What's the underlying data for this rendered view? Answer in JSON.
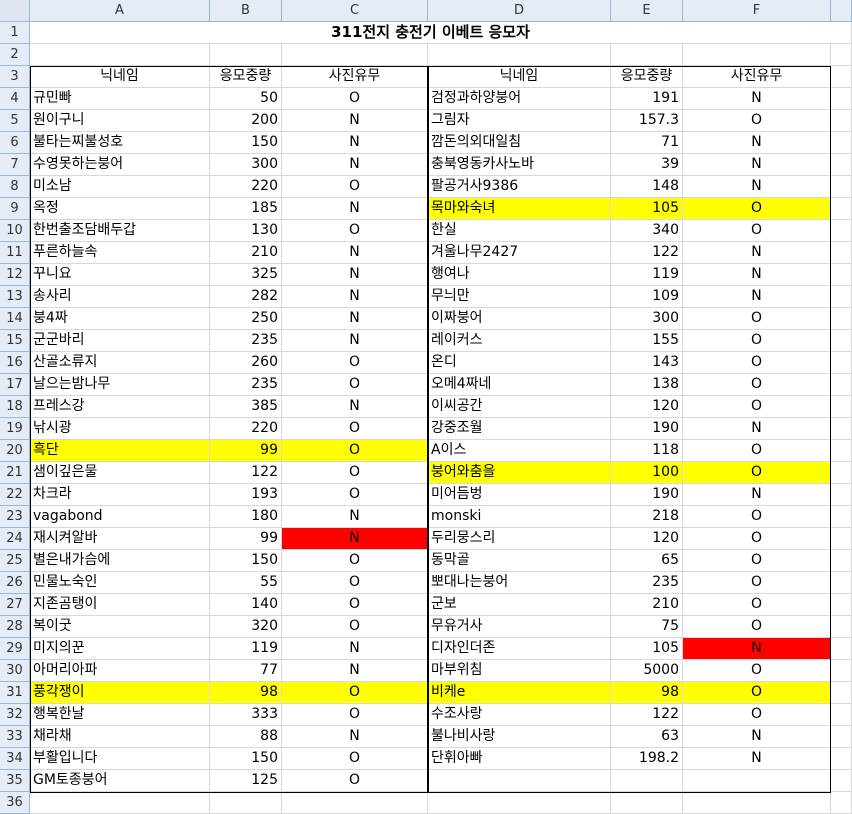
{
  "columns": [
    "A",
    "B",
    "C",
    "D",
    "E",
    "F"
  ],
  "row_count": 36,
  "title": "311전지 충전기 이베트 응모자",
  "headers": [
    "닉네임",
    "응모중량",
    "사진유무"
  ],
  "left": [
    {
      "row": 4,
      "name": "규민빠",
      "weight": "50",
      "photo": "O"
    },
    {
      "row": 5,
      "name": "원이구니",
      "weight": "200",
      "photo": "N"
    },
    {
      "row": 6,
      "name": "불타는찌불성호",
      "weight": "150",
      "photo": "N"
    },
    {
      "row": 7,
      "name": "수영못하는붕어",
      "weight": "300",
      "photo": "N"
    },
    {
      "row": 8,
      "name": "미소남",
      "weight": "220",
      "photo": "O"
    },
    {
      "row": 9,
      "name": "옥정",
      "weight": "185",
      "photo": "N"
    },
    {
      "row": 10,
      "name": "한번출조담배두갑",
      "weight": "130",
      "photo": "O"
    },
    {
      "row": 11,
      "name": "푸른하늘속",
      "weight": "210",
      "photo": "N"
    },
    {
      "row": 12,
      "name": "꾸니요",
      "weight": "325",
      "photo": "N"
    },
    {
      "row": 13,
      "name": "송사리",
      "weight": "282",
      "photo": "N"
    },
    {
      "row": 14,
      "name": "붕4짜",
      "weight": "250",
      "photo": "N"
    },
    {
      "row": 15,
      "name": "군군바리",
      "weight": "235",
      "photo": "N"
    },
    {
      "row": 16,
      "name": "산골소류지",
      "weight": "260",
      "photo": "O"
    },
    {
      "row": 17,
      "name": "날으는밤나무",
      "weight": "235",
      "photo": "O"
    },
    {
      "row": 18,
      "name": "프레스강",
      "weight": "385",
      "photo": "N"
    },
    {
      "row": 19,
      "name": "낚시광",
      "weight": "220",
      "photo": "O"
    },
    {
      "row": 20,
      "name": "흑단",
      "weight": "99",
      "photo": "O",
      "hl": "yellow"
    },
    {
      "row": 21,
      "name": "샘이깊은물",
      "weight": "122",
      "photo": "O"
    },
    {
      "row": 22,
      "name": "차크라",
      "weight": "193",
      "photo": "O"
    },
    {
      "row": 23,
      "name": "vagabond",
      "weight": "180",
      "photo": "N"
    },
    {
      "row": 24,
      "name": "재시켜알바",
      "weight": "99",
      "photo": "N",
      "hl_photo": "red"
    },
    {
      "row": 25,
      "name": "별은내가슴에",
      "weight": "150",
      "photo": "O"
    },
    {
      "row": 26,
      "name": "민물노숙인",
      "weight": "55",
      "photo": "O"
    },
    {
      "row": 27,
      "name": "지존곰탱이",
      "weight": "140",
      "photo": "O"
    },
    {
      "row": 28,
      "name": "복이굿",
      "weight": "320",
      "photo": "O"
    },
    {
      "row": 29,
      "name": "미지의꾼",
      "weight": "119",
      "photo": "N"
    },
    {
      "row": 30,
      "name": "아머리아파",
      "weight": "77",
      "photo": "N"
    },
    {
      "row": 31,
      "name": "풍각쟁이",
      "weight": "98",
      "photo": "O",
      "hl": "yellow"
    },
    {
      "row": 32,
      "name": "행복한날",
      "weight": "333",
      "photo": "O"
    },
    {
      "row": 33,
      "name": "채라채",
      "weight": "88",
      "photo": "N"
    },
    {
      "row": 34,
      "name": "부활입니다",
      "weight": "150",
      "photo": "O"
    },
    {
      "row": 35,
      "name": "GM토종붕어",
      "weight": "125",
      "photo": "O"
    }
  ],
  "right": [
    {
      "row": 4,
      "name": "검정과하양붕어",
      "weight": "191",
      "photo": "N"
    },
    {
      "row": 5,
      "name": "그림자",
      "weight": "157.3",
      "photo": "O"
    },
    {
      "row": 6,
      "name": "깜돈의외대일침",
      "weight": "71",
      "photo": "N"
    },
    {
      "row": 7,
      "name": "충북영동카사노바",
      "weight": "39",
      "photo": "N"
    },
    {
      "row": 8,
      "name": "팔공거사9386",
      "weight": "148",
      "photo": "N"
    },
    {
      "row": 9,
      "name": "목마와숙녀",
      "weight": "105",
      "photo": "O",
      "hl": "yellow"
    },
    {
      "row": 10,
      "name": "한실",
      "weight": "340",
      "photo": "O"
    },
    {
      "row": 11,
      "name": "겨울나무2427",
      "weight": "122",
      "photo": "N"
    },
    {
      "row": 12,
      "name": "행여나",
      "weight": "119",
      "photo": "N"
    },
    {
      "row": 13,
      "name": "무늬만",
      "weight": "109",
      "photo": "N"
    },
    {
      "row": 14,
      "name": "이짜붕어",
      "weight": "300",
      "photo": "O"
    },
    {
      "row": 15,
      "name": "레이커스",
      "weight": "155",
      "photo": "O"
    },
    {
      "row": 16,
      "name": "온디",
      "weight": "143",
      "photo": "O"
    },
    {
      "row": 17,
      "name": "오메4짜네",
      "weight": "138",
      "photo": "O"
    },
    {
      "row": 18,
      "name": "이씨공간",
      "weight": "120",
      "photo": "O"
    },
    {
      "row": 19,
      "name": "강중조월",
      "weight": "190",
      "photo": "N"
    },
    {
      "row": 20,
      "name": "A이스",
      "weight": "118",
      "photo": "O"
    },
    {
      "row": 21,
      "name": "붕어와춤을",
      "weight": "100",
      "photo": "O",
      "hl": "yellow"
    },
    {
      "row": 22,
      "name": "미어듬벙",
      "weight": "190",
      "photo": "N"
    },
    {
      "row": 23,
      "name": "monski",
      "weight": "218",
      "photo": "O"
    },
    {
      "row": 24,
      "name": "두리뭉스리",
      "weight": "120",
      "photo": "O"
    },
    {
      "row": 25,
      "name": "동막골",
      "weight": "65",
      "photo": "O"
    },
    {
      "row": 26,
      "name": "뽀대나는붕어",
      "weight": "235",
      "photo": "O"
    },
    {
      "row": 27,
      "name": "군보",
      "weight": "210",
      "photo": "O"
    },
    {
      "row": 28,
      "name": "무유거사",
      "weight": "75",
      "photo": "O"
    },
    {
      "row": 29,
      "name": "디자인더존",
      "weight": "105",
      "photo": "N",
      "hl_photo": "red"
    },
    {
      "row": 30,
      "name": "마부위침",
      "weight": "5000",
      "photo": "O"
    },
    {
      "row": 31,
      "name": "비케e",
      "weight": "98",
      "photo": "O",
      "hl": "yellow"
    },
    {
      "row": 32,
      "name": "수조사랑",
      "weight": "122",
      "photo": "O"
    },
    {
      "row": 33,
      "name": "불나비사랑",
      "weight": "63",
      "photo": "N"
    },
    {
      "row": 34,
      "name": "단휘아빠",
      "weight": "198.2",
      "photo": "N"
    }
  ]
}
